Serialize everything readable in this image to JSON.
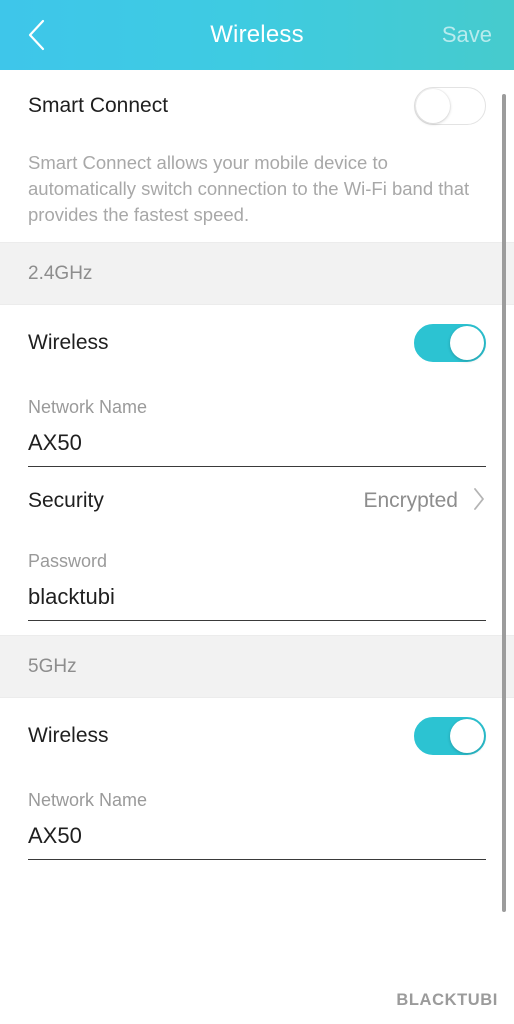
{
  "header": {
    "title": "Wireless",
    "back_icon": "chevron-left-icon",
    "save_label": "Save",
    "gradient_from": "#3ec6ea",
    "gradient_to": "#46cbcd"
  },
  "smart_connect": {
    "label": "Smart Connect",
    "toggle_state": "off",
    "description": "Smart Connect allows your mobile device to automatically switch connection to the Wi-Fi band that provides the fastest speed."
  },
  "bands": [
    {
      "name": "2.4GHz",
      "wireless_label": "Wireless",
      "wireless_toggle_state": "on",
      "network_name_label": "Network Name",
      "network_name_value": "AX50",
      "security_label": "Security",
      "security_value": "Encrypted",
      "security_chevron_icon": "chevron-right-icon",
      "password_label": "Password",
      "password_value": "blacktubi"
    },
    {
      "name": "5GHz",
      "wireless_label": "Wireless",
      "wireless_toggle_state": "on",
      "network_name_label": "Network Name",
      "network_name_value": "AX50"
    }
  ],
  "watermark": "BLACKTUBI",
  "colors": {
    "accent": "#2cc3d2",
    "band_header_bg": "#f2f2f2",
    "muted_text": "#9a9a9a",
    "primary_text": "#1f1f1f"
  }
}
